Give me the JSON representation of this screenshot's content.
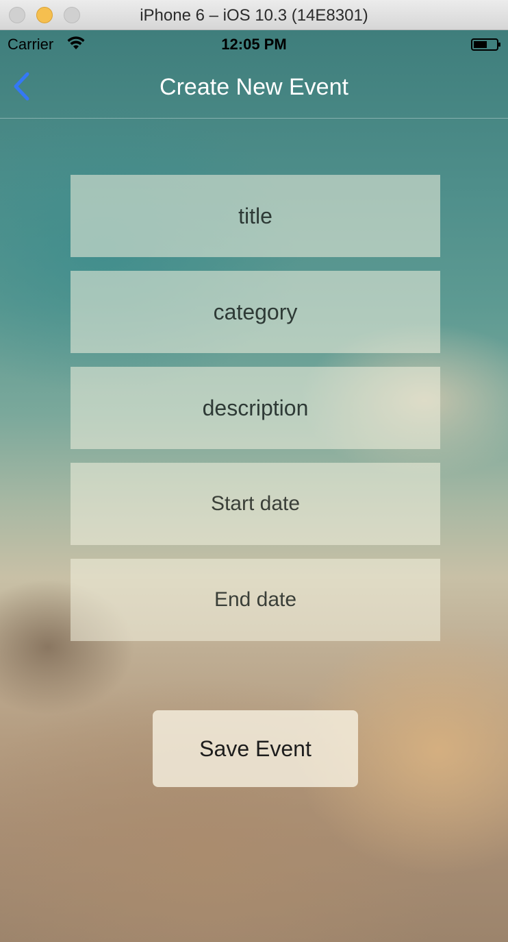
{
  "window": {
    "title": "iPhone 6 – iOS 10.3 (14E8301)"
  },
  "status_bar": {
    "carrier": "Carrier",
    "time": "12:05 PM"
  },
  "nav": {
    "title": "Create New Event",
    "accent_color": "#3478f6"
  },
  "form": {
    "title_placeholder": "title",
    "category_placeholder": "category",
    "description_placeholder": "description",
    "start_date_placeholder": "Start date",
    "end_date_placeholder": "End date"
  },
  "actions": {
    "save_label": "Save Event"
  }
}
